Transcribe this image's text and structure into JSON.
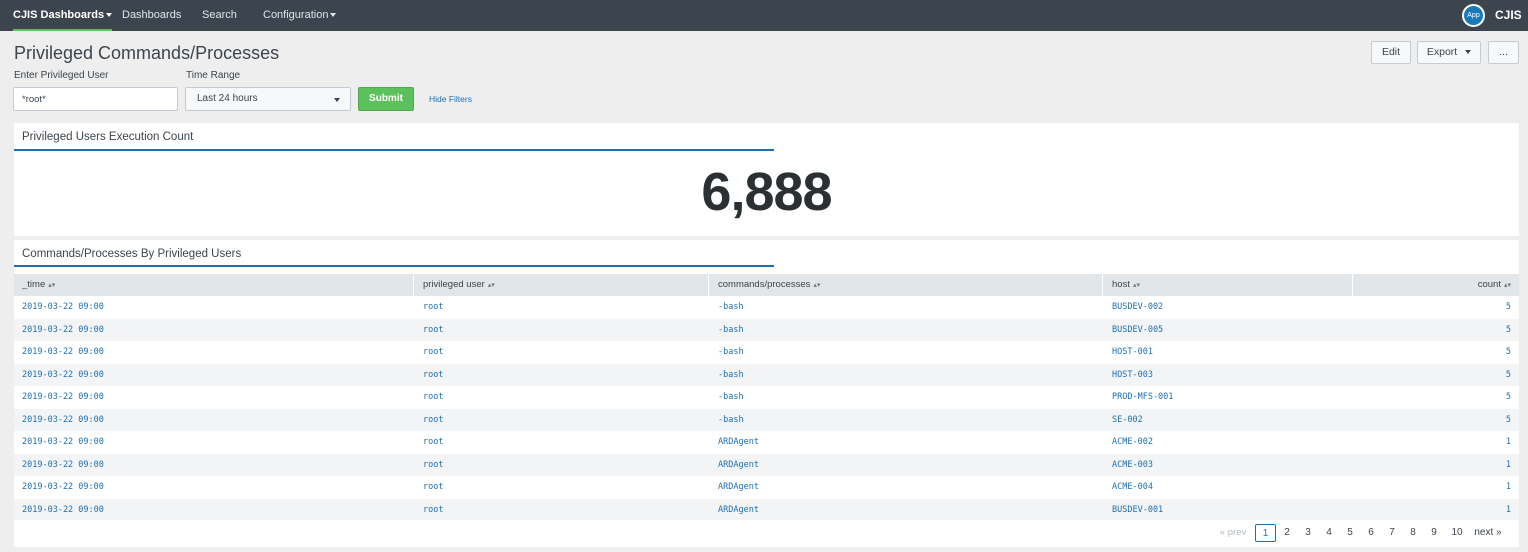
{
  "nav": {
    "items": [
      {
        "label": "CJIS Dashboards",
        "active": true,
        "dropdown": true
      },
      {
        "label": "Dashboards",
        "active": false,
        "dropdown": false
      },
      {
        "label": "Search",
        "active": false,
        "dropdown": false
      },
      {
        "label": "Configuration",
        "active": false,
        "dropdown": true
      }
    ],
    "app_badge": "App",
    "app_name": "CJIS"
  },
  "header": {
    "title": "Privileged Commands/Processes",
    "edit_label": "Edit",
    "export_label": "Export",
    "more_label": "..."
  },
  "filters": {
    "user_label": "Enter Privileged User",
    "user_value": "*root*",
    "time_label": "Time Range",
    "time_value": "Last 24 hours",
    "submit_label": "Submit",
    "hide_label": "Hide Filters"
  },
  "count_panel": {
    "title": "Privileged Users Execution Count",
    "value": "6,888"
  },
  "table_panel": {
    "title": "Commands/Processes By Privileged Users",
    "columns": [
      "_time",
      "privileged user",
      "commands/processes",
      "host",
      "count"
    ],
    "rows": [
      {
        "time": "2019-03-22 09:00",
        "user": "root",
        "command": "-bash",
        "host": "BUSDEV-002",
        "count": "5"
      },
      {
        "time": "2019-03-22 09:00",
        "user": "root",
        "command": "-bash",
        "host": "BUSDEV-005",
        "count": "5"
      },
      {
        "time": "2019-03-22 09:00",
        "user": "root",
        "command": "-bash",
        "host": "HOST-001",
        "count": "5"
      },
      {
        "time": "2019-03-22 09:00",
        "user": "root",
        "command": "-bash",
        "host": "HOST-003",
        "count": "5"
      },
      {
        "time": "2019-03-22 09:00",
        "user": "root",
        "command": "-bash",
        "host": "PROD-MFS-001",
        "count": "5"
      },
      {
        "time": "2019-03-22 09:00",
        "user": "root",
        "command": "-bash",
        "host": "SE-002",
        "count": "5"
      },
      {
        "time": "2019-03-22 09:00",
        "user": "root",
        "command": "ARDAgent",
        "host": "ACME-002",
        "count": "1"
      },
      {
        "time": "2019-03-22 09:00",
        "user": "root",
        "command": "ARDAgent",
        "host": "ACME-003",
        "count": "1"
      },
      {
        "time": "2019-03-22 09:00",
        "user": "root",
        "command": "ARDAgent",
        "host": "ACME-004",
        "count": "1"
      },
      {
        "time": "2019-03-22 09:00",
        "user": "root",
        "command": "ARDAgent",
        "host": "BUSDEV-001",
        "count": "1"
      }
    ]
  },
  "pagination": {
    "prev_label": "« prev",
    "pages": [
      "1",
      "2",
      "3",
      "4",
      "5",
      "6",
      "7",
      "8",
      "9",
      "10"
    ],
    "current": "1",
    "next_label": "next »"
  },
  "colors": {
    "nav_bg": "#3c444d",
    "accent_blue": "#1e6faf",
    "submit_green": "#5cc05c"
  }
}
